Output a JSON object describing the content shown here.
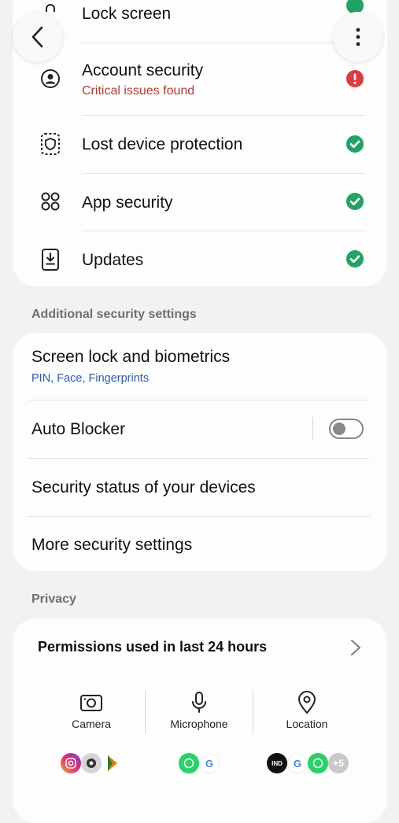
{
  "top_card": {
    "items": [
      {
        "label": "Lock screen",
        "status": "ok"
      },
      {
        "label": "Account security",
        "sublabel": "Critical issues found",
        "status": "critical"
      },
      {
        "label": "Lost device protection",
        "status": "ok"
      },
      {
        "label": "App security",
        "status": "ok"
      },
      {
        "label": "Updates",
        "status": "ok"
      }
    ]
  },
  "additional": {
    "header": "Additional security settings",
    "items": [
      {
        "label": "Screen lock and biometrics",
        "sublabel": "PIN, Face, Fingerprints"
      },
      {
        "label": "Auto Blocker",
        "toggle": false
      },
      {
        "label": "Security status of your devices"
      },
      {
        "label": "More security settings"
      }
    ]
  },
  "privacy": {
    "header": "Privacy",
    "permissions_title": "Permissions used in last 24 hours",
    "permissions": [
      {
        "label": "Camera",
        "apps": [
          "Instagram",
          "Camera",
          "Pay"
        ]
      },
      {
        "label": "Microphone",
        "apps": [
          "WhatsApp",
          "Google"
        ]
      },
      {
        "label": "Location",
        "apps": [
          "IND money",
          "Google",
          "WhatsApp"
        ],
        "more": "+5"
      }
    ]
  },
  "colors": {
    "ok": "#1fa463",
    "critical": "#e0393e",
    "sublabel_blue": "#2a5bb8",
    "critical_text": "#c0392b"
  },
  "icons": {
    "back": "chevron-left-icon",
    "more": "more-vertical-icon"
  }
}
